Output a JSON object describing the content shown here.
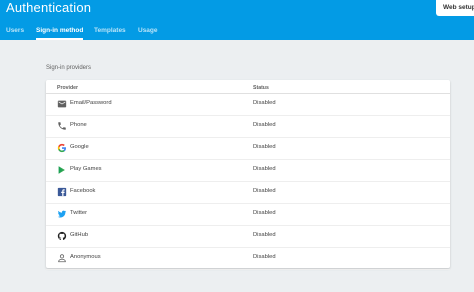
{
  "header": {
    "title": "Authentication",
    "web_setup_label": "Web setup"
  },
  "tabs": [
    {
      "label": "Users"
    },
    {
      "label": "Sign-in method"
    },
    {
      "label": "Templates"
    },
    {
      "label": "Usage"
    }
  ],
  "section_title": "Sign-in providers",
  "table": {
    "columns": [
      "Provider",
      "Status"
    ],
    "rows": [
      {
        "provider": "Email/Password",
        "status": "Disabled",
        "icon": "email-icon"
      },
      {
        "provider": "Phone",
        "status": "Disabled",
        "icon": "phone-icon"
      },
      {
        "provider": "Google",
        "status": "Disabled",
        "icon": "google-icon"
      },
      {
        "provider": "Play Games",
        "status": "Disabled",
        "icon": "play-games-icon"
      },
      {
        "provider": "Facebook",
        "status": "Disabled",
        "icon": "facebook-icon"
      },
      {
        "provider": "Twitter",
        "status": "Disabled",
        "icon": "twitter-icon"
      },
      {
        "provider": "GitHub",
        "status": "Disabled",
        "icon": "github-icon"
      },
      {
        "provider": "Anonymous",
        "status": "Disabled",
        "icon": "anonymous-icon"
      }
    ]
  },
  "colors": {
    "header_bg": "#039be5",
    "page_bg": "#eceff1",
    "facebook": "#3b5998",
    "twitter": "#1da1f2",
    "play_games": "#34a853"
  }
}
